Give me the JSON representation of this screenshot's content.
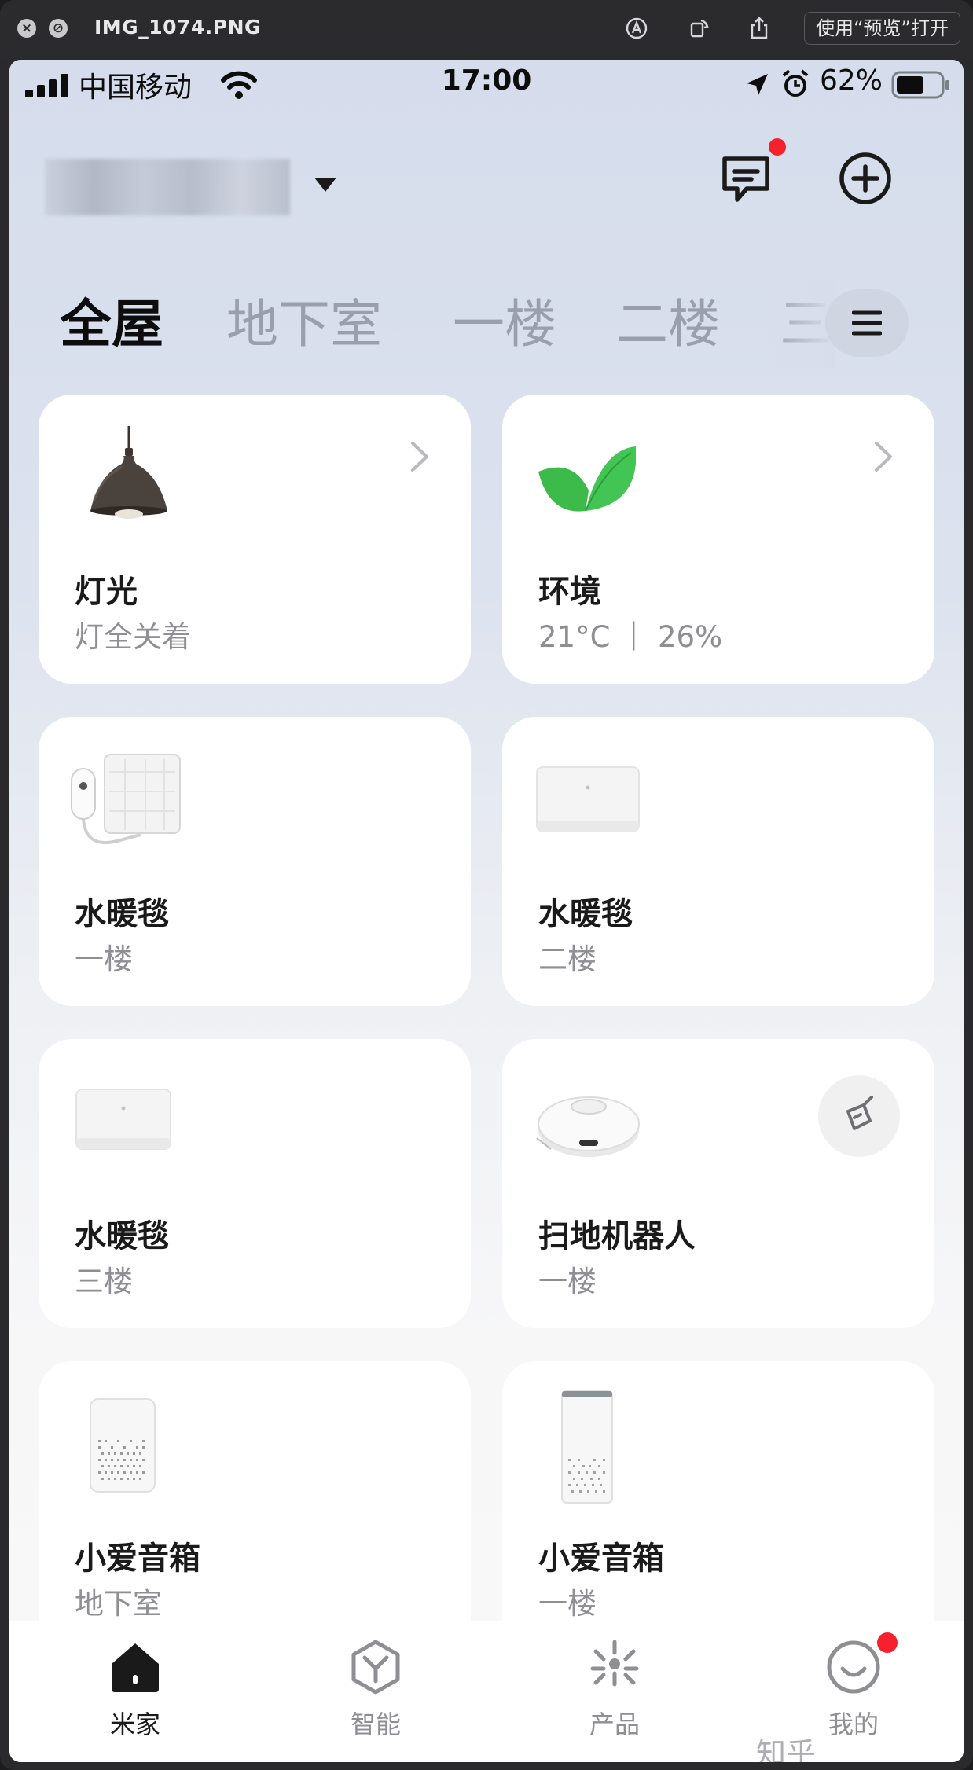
{
  "window": {
    "title": "IMG_1074.PNG",
    "open_with_label": "使用“预览”打开"
  },
  "status_bar": {
    "carrier": "中国移动",
    "time": "17:00",
    "battery": "62%"
  },
  "tabs": [
    {
      "label": "全屋",
      "active": true
    },
    {
      "label": "地下室"
    },
    {
      "label": "一楼"
    },
    {
      "label": "二楼"
    },
    {
      "label": "三"
    }
  ],
  "cards": [
    {
      "name": "灯光",
      "sub": "灯全关着",
      "icon": "pendant-lamp-icon",
      "arrow": true
    },
    {
      "name": "环境",
      "sub": "21°C ｜ 26%",
      "icon": "leaf-icon",
      "arrow": true
    },
    {
      "name": "水暖毯",
      "sub": "一楼",
      "icon": "heated-blanket-icon"
    },
    {
      "name": "水暖毯",
      "sub": "二楼",
      "icon": "water-heater-box-icon"
    },
    {
      "name": "水暖毯",
      "sub": "三楼",
      "icon": "water-heater-box-icon"
    },
    {
      "name": "扫地机器人",
      "sub": "一楼",
      "icon": "robot-vacuum-icon",
      "action": "sweep-icon"
    },
    {
      "name": "小爱音箱",
      "sub": "地下室",
      "icon": "smart-speaker-icon"
    },
    {
      "name": "小爱音箱",
      "sub": "一楼",
      "icon": "tall-speaker-icon"
    }
  ],
  "tabbar": [
    {
      "label": "米家",
      "icon": "home-icon",
      "active": true
    },
    {
      "label": "智能",
      "icon": "smart-icon"
    },
    {
      "label": "产品",
      "icon": "product-icon"
    },
    {
      "label": "我的",
      "icon": "profile-icon",
      "badge": true
    }
  ],
  "watermark": "知乎 @GeeCar",
  "colors": {
    "badge": "#f5222d",
    "leaf": "#3dbb4a",
    "text_primary": "#1a1a1a",
    "text_secondary": "#8e8e93"
  }
}
